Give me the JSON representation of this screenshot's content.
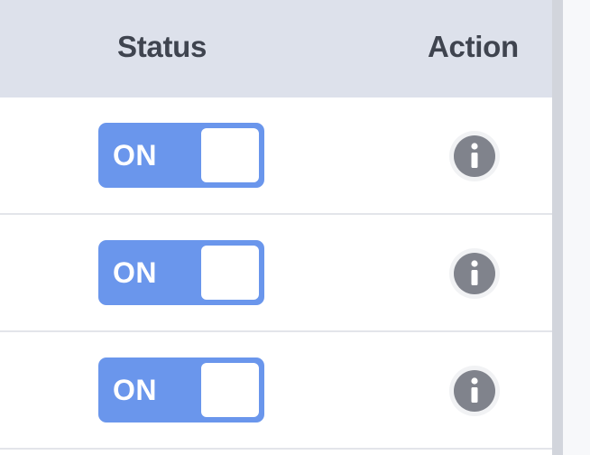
{
  "table": {
    "headers": {
      "status": "Status",
      "action": "Action"
    },
    "rows": [
      {
        "status_label": "ON",
        "action_icon": "info-icon"
      },
      {
        "status_label": "ON",
        "action_icon": "info-icon"
      },
      {
        "status_label": "ON",
        "action_icon": "info-icon"
      }
    ]
  },
  "colors": {
    "header_bg": "#dde1eb",
    "toggle_on": "#6a96ec",
    "info_icon": "#80838c"
  }
}
